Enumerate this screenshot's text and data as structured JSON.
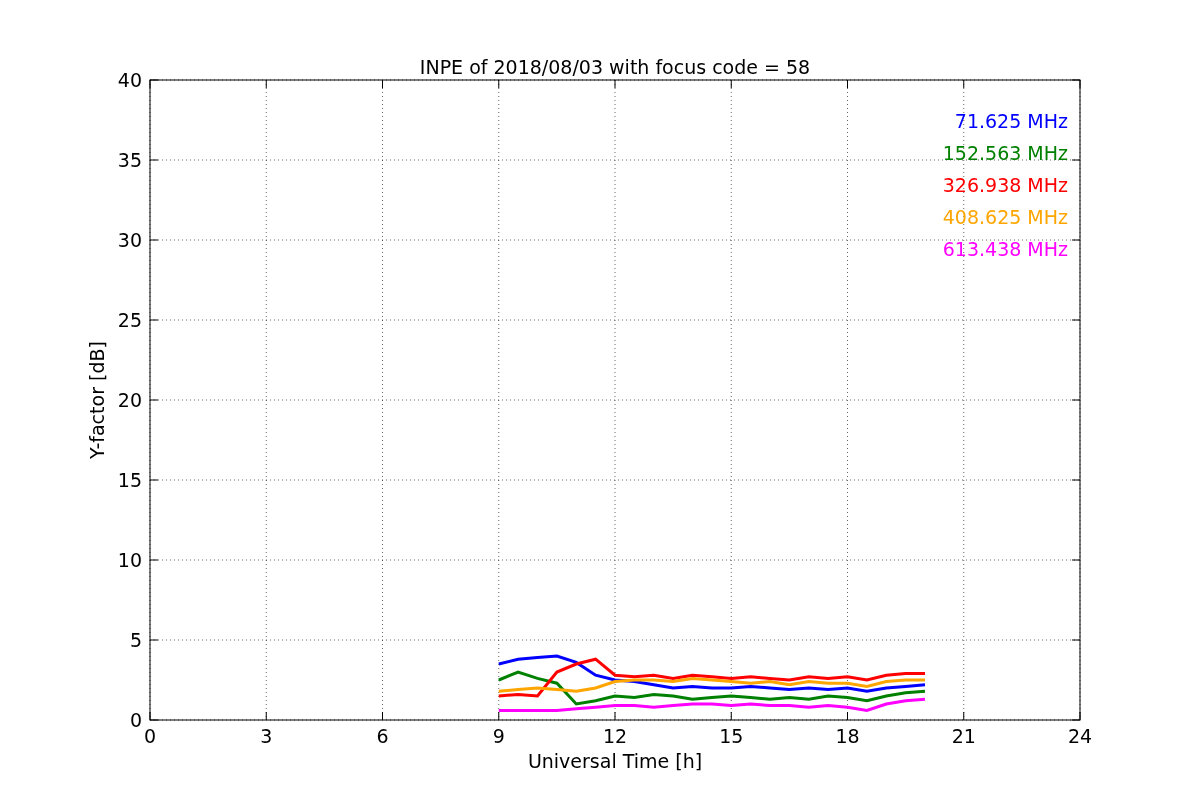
{
  "chart_data": {
    "type": "line",
    "title": "INPE of 2018/08/03 with focus code = 58",
    "xlabel": "Universal Time [h]",
    "ylabel": "Y-factor [dB]",
    "x": [
      9,
      9.5,
      10,
      10.5,
      11,
      11.5,
      12,
      12.5,
      13,
      13.5,
      14,
      14.5,
      15,
      15.5,
      16,
      16.5,
      17,
      17.5,
      18,
      18.5,
      19,
      19.5,
      20
    ],
    "series": [
      {
        "name": "71.625 MHz",
        "color": "#0000ff",
        "values": [
          3.5,
          3.8,
          3.9,
          4.0,
          3.6,
          2.8,
          2.5,
          2.4,
          2.2,
          2.0,
          2.1,
          2.0,
          2.0,
          2.1,
          2.0,
          1.9,
          2.0,
          1.9,
          2.0,
          1.8,
          2.0,
          2.1,
          2.2
        ]
      },
      {
        "name": "152.563 MHz",
        "color": "#008000",
        "values": [
          2.5,
          3.0,
          2.6,
          2.3,
          1.0,
          1.2,
          1.5,
          1.4,
          1.6,
          1.5,
          1.3,
          1.4,
          1.5,
          1.4,
          1.3,
          1.4,
          1.3,
          1.5,
          1.4,
          1.2,
          1.5,
          1.7,
          1.8
        ]
      },
      {
        "name": "326.938 MHz",
        "color": "#ff0000",
        "values": [
          1.5,
          1.6,
          1.5,
          3.0,
          3.5,
          3.8,
          2.8,
          2.7,
          2.8,
          2.6,
          2.8,
          2.7,
          2.6,
          2.7,
          2.6,
          2.5,
          2.7,
          2.6,
          2.7,
          2.5,
          2.8,
          2.9,
          2.9
        ]
      },
      {
        "name": "408.625 MHz",
        "color": "#ffa500",
        "values": [
          1.8,
          1.9,
          2.0,
          1.9,
          1.8,
          2.0,
          2.4,
          2.5,
          2.5,
          2.4,
          2.6,
          2.5,
          2.4,
          2.3,
          2.4,
          2.2,
          2.4,
          2.3,
          2.3,
          2.1,
          2.4,
          2.5,
          2.5
        ]
      },
      {
        "name": "613.438 MHz",
        "color": "#ff00ff",
        "values": [
          0.6,
          0.6,
          0.6,
          0.6,
          0.7,
          0.8,
          0.9,
          0.9,
          0.8,
          0.9,
          1.0,
          1.0,
          0.9,
          1.0,
          0.9,
          0.9,
          0.8,
          0.9,
          0.8,
          0.6,
          1.0,
          1.2,
          1.3
        ]
      }
    ],
    "xlim": [
      0,
      24
    ],
    "ylim": [
      0,
      40
    ],
    "xticks": [
      0,
      3,
      6,
      9,
      12,
      15,
      18,
      21,
      24
    ],
    "yticks": [
      0,
      5,
      10,
      15,
      20,
      25,
      30,
      35,
      40
    ],
    "grid": true
  }
}
